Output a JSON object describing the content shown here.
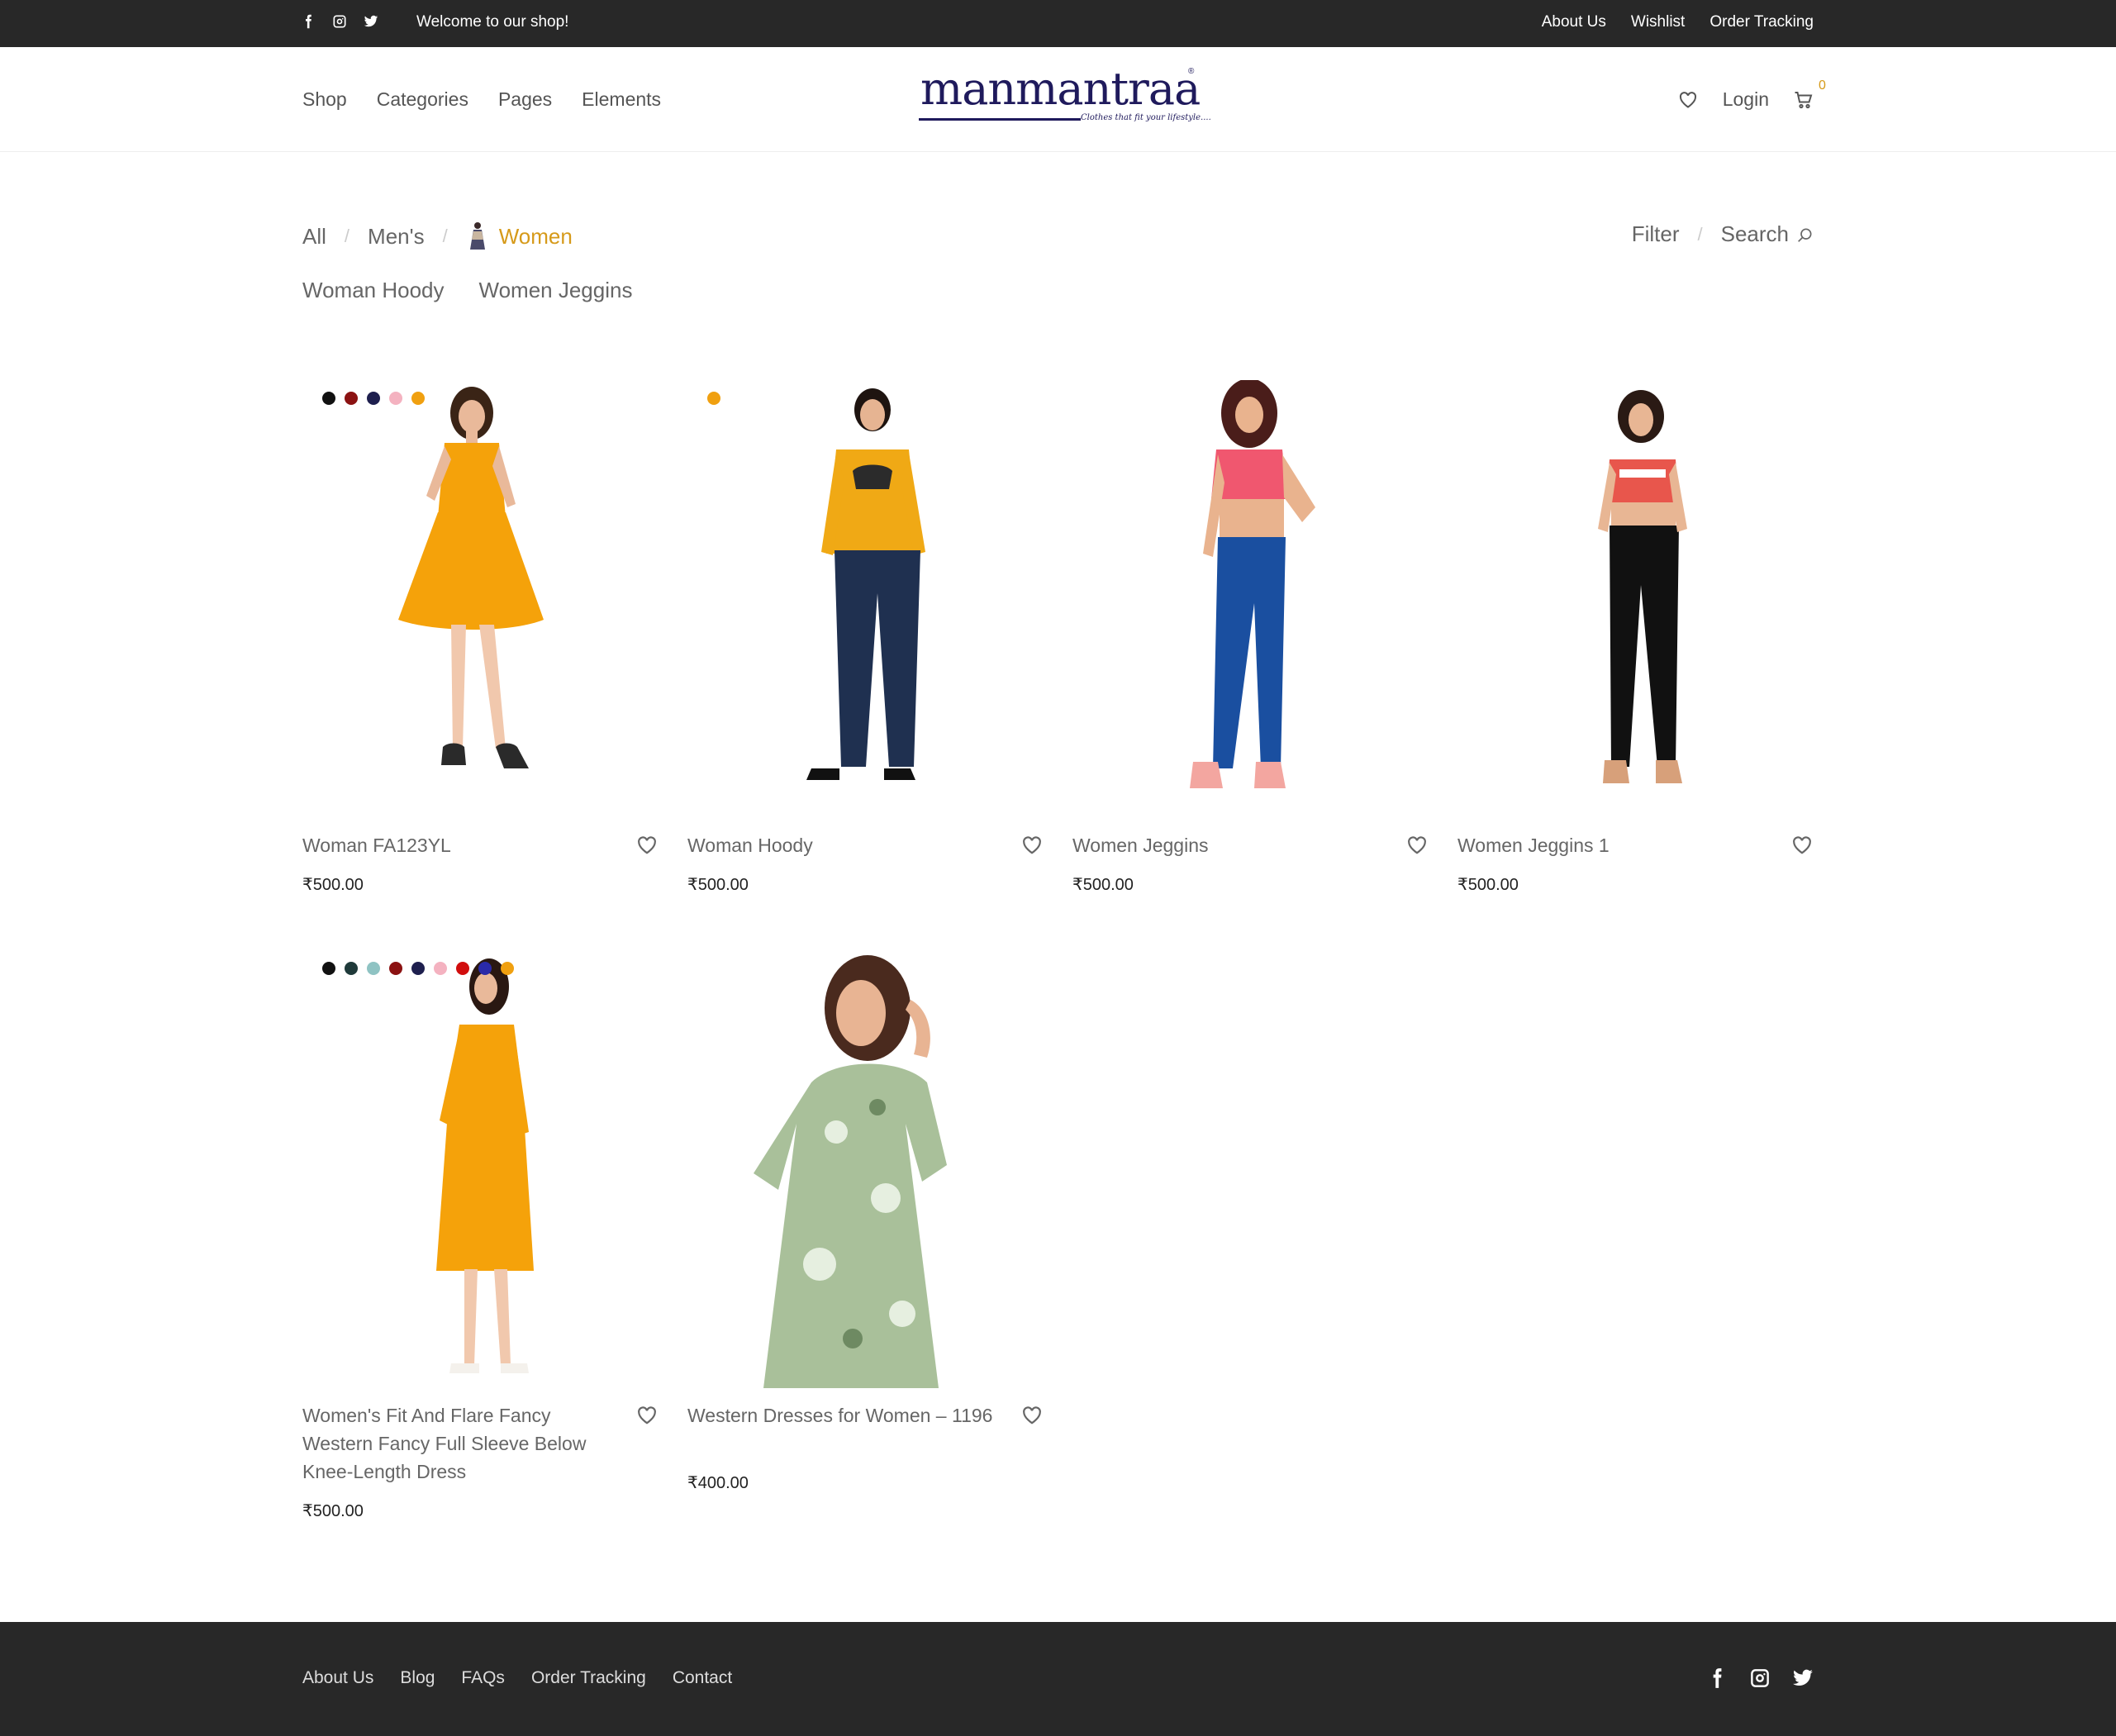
{
  "topbar": {
    "welcome": "Welcome to our shop!",
    "social_icons": [
      "facebook-icon",
      "instagram-icon",
      "twitter-icon"
    ],
    "links": [
      "About Us",
      "Wishlist",
      "Order Tracking"
    ]
  },
  "header": {
    "nav": [
      "Shop",
      "Categories",
      "Pages",
      "Elements"
    ],
    "logo_text": "manmantraa",
    "logo_tagline": "Clothes that fit your lifestyle....",
    "login": "Login",
    "cart_count": "0",
    "icons": [
      "heart-icon",
      "cart-icon"
    ]
  },
  "filters": {
    "categories": [
      "All",
      "Men's",
      "Women"
    ],
    "active_category": "Women",
    "subcategories": [
      "Woman Hoody",
      "Women Jeggins"
    ],
    "filter_label": "Filter",
    "search_label": "Search"
  },
  "colors": {
    "accent": "#d69a1a",
    "topbar_bg": "#282828",
    "footer_bg": "#282828"
  },
  "products": [
    {
      "title": "Woman FA123YL",
      "price": "₹500.00",
      "swatches": [
        "#111111",
        "#8b1212",
        "#1e1f4e",
        "#f4b2c0",
        "#f0a010"
      ]
    },
    {
      "title": "Woman Hoody",
      "price": "₹500.00",
      "swatches": [
        "#f0a010"
      ]
    },
    {
      "title": "Women Jeggins",
      "price": "₹500.00",
      "swatches": []
    },
    {
      "title": "Women Jeggins 1",
      "price": "₹500.00",
      "swatches": []
    },
    {
      "title": "Women's Fit And Flare Fancy Western Fancy Full Sleeve Below Knee-Length Dress",
      "price": "₹500.00",
      "swatches": [
        "#111111",
        "#1f3a3a",
        "#8fc3c3",
        "#8b1212",
        "#1e1f4e",
        "#f4b2c0",
        "#d10d0d",
        "#2a2aa8",
        "#f0a010"
      ]
    },
    {
      "title": "Western Dresses for Women – 1196",
      "price": "₹400.00",
      "swatches": []
    }
  ],
  "footer": {
    "links": [
      "About Us",
      "Blog",
      "FAQs",
      "Order Tracking",
      "Contact"
    ],
    "social_icons": [
      "facebook-icon",
      "instagram-icon",
      "twitter-icon"
    ]
  }
}
